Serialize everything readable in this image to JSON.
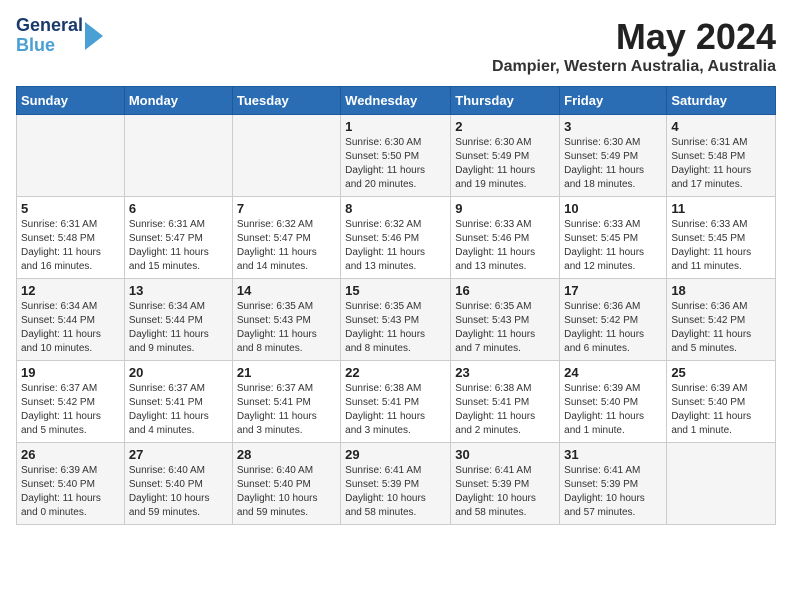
{
  "header": {
    "logo_line1": "General",
    "logo_line2": "Blue",
    "title": "May 2024",
    "subtitle": "Dampier, Western Australia, Australia"
  },
  "weekdays": [
    "Sunday",
    "Monday",
    "Tuesday",
    "Wednesday",
    "Thursday",
    "Friday",
    "Saturday"
  ],
  "weeks": [
    [
      {
        "num": "",
        "info": ""
      },
      {
        "num": "",
        "info": ""
      },
      {
        "num": "",
        "info": ""
      },
      {
        "num": "1",
        "info": "Sunrise: 6:30 AM\nSunset: 5:50 PM\nDaylight: 11 hours\nand 20 minutes."
      },
      {
        "num": "2",
        "info": "Sunrise: 6:30 AM\nSunset: 5:49 PM\nDaylight: 11 hours\nand 19 minutes."
      },
      {
        "num": "3",
        "info": "Sunrise: 6:30 AM\nSunset: 5:49 PM\nDaylight: 11 hours\nand 18 minutes."
      },
      {
        "num": "4",
        "info": "Sunrise: 6:31 AM\nSunset: 5:48 PM\nDaylight: 11 hours\nand 17 minutes."
      }
    ],
    [
      {
        "num": "5",
        "info": "Sunrise: 6:31 AM\nSunset: 5:48 PM\nDaylight: 11 hours\nand 16 minutes."
      },
      {
        "num": "6",
        "info": "Sunrise: 6:31 AM\nSunset: 5:47 PM\nDaylight: 11 hours\nand 15 minutes."
      },
      {
        "num": "7",
        "info": "Sunrise: 6:32 AM\nSunset: 5:47 PM\nDaylight: 11 hours\nand 14 minutes."
      },
      {
        "num": "8",
        "info": "Sunrise: 6:32 AM\nSunset: 5:46 PM\nDaylight: 11 hours\nand 13 minutes."
      },
      {
        "num": "9",
        "info": "Sunrise: 6:33 AM\nSunset: 5:46 PM\nDaylight: 11 hours\nand 13 minutes."
      },
      {
        "num": "10",
        "info": "Sunrise: 6:33 AM\nSunset: 5:45 PM\nDaylight: 11 hours\nand 12 minutes."
      },
      {
        "num": "11",
        "info": "Sunrise: 6:33 AM\nSunset: 5:45 PM\nDaylight: 11 hours\nand 11 minutes."
      }
    ],
    [
      {
        "num": "12",
        "info": "Sunrise: 6:34 AM\nSunset: 5:44 PM\nDaylight: 11 hours\nand 10 minutes."
      },
      {
        "num": "13",
        "info": "Sunrise: 6:34 AM\nSunset: 5:44 PM\nDaylight: 11 hours\nand 9 minutes."
      },
      {
        "num": "14",
        "info": "Sunrise: 6:35 AM\nSunset: 5:43 PM\nDaylight: 11 hours\nand 8 minutes."
      },
      {
        "num": "15",
        "info": "Sunrise: 6:35 AM\nSunset: 5:43 PM\nDaylight: 11 hours\nand 8 minutes."
      },
      {
        "num": "16",
        "info": "Sunrise: 6:35 AM\nSunset: 5:43 PM\nDaylight: 11 hours\nand 7 minutes."
      },
      {
        "num": "17",
        "info": "Sunrise: 6:36 AM\nSunset: 5:42 PM\nDaylight: 11 hours\nand 6 minutes."
      },
      {
        "num": "18",
        "info": "Sunrise: 6:36 AM\nSunset: 5:42 PM\nDaylight: 11 hours\nand 5 minutes."
      }
    ],
    [
      {
        "num": "19",
        "info": "Sunrise: 6:37 AM\nSunset: 5:42 PM\nDaylight: 11 hours\nand 5 minutes."
      },
      {
        "num": "20",
        "info": "Sunrise: 6:37 AM\nSunset: 5:41 PM\nDaylight: 11 hours\nand 4 minutes."
      },
      {
        "num": "21",
        "info": "Sunrise: 6:37 AM\nSunset: 5:41 PM\nDaylight: 11 hours\nand 3 minutes."
      },
      {
        "num": "22",
        "info": "Sunrise: 6:38 AM\nSunset: 5:41 PM\nDaylight: 11 hours\nand 3 minutes."
      },
      {
        "num": "23",
        "info": "Sunrise: 6:38 AM\nSunset: 5:41 PM\nDaylight: 11 hours\nand 2 minutes."
      },
      {
        "num": "24",
        "info": "Sunrise: 6:39 AM\nSunset: 5:40 PM\nDaylight: 11 hours\nand 1 minute."
      },
      {
        "num": "25",
        "info": "Sunrise: 6:39 AM\nSunset: 5:40 PM\nDaylight: 11 hours\nand 1 minute."
      }
    ],
    [
      {
        "num": "26",
        "info": "Sunrise: 6:39 AM\nSunset: 5:40 PM\nDaylight: 11 hours\nand 0 minutes."
      },
      {
        "num": "27",
        "info": "Sunrise: 6:40 AM\nSunset: 5:40 PM\nDaylight: 10 hours\nand 59 minutes."
      },
      {
        "num": "28",
        "info": "Sunrise: 6:40 AM\nSunset: 5:40 PM\nDaylight: 10 hours\nand 59 minutes."
      },
      {
        "num": "29",
        "info": "Sunrise: 6:41 AM\nSunset: 5:39 PM\nDaylight: 10 hours\nand 58 minutes."
      },
      {
        "num": "30",
        "info": "Sunrise: 6:41 AM\nSunset: 5:39 PM\nDaylight: 10 hours\nand 58 minutes."
      },
      {
        "num": "31",
        "info": "Sunrise: 6:41 AM\nSunset: 5:39 PM\nDaylight: 10 hours\nand 57 minutes."
      },
      {
        "num": "",
        "info": ""
      }
    ]
  ]
}
